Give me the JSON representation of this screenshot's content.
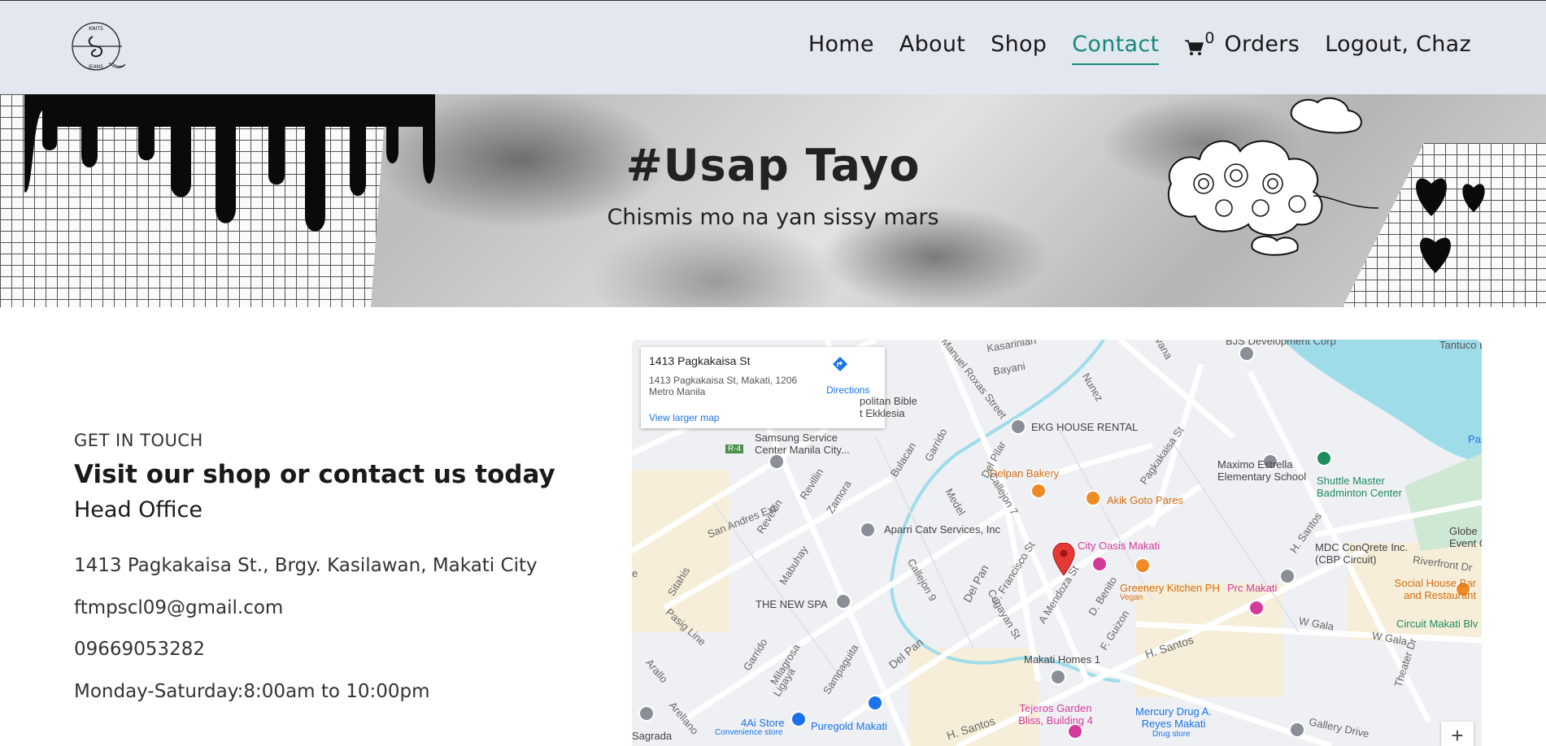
{
  "nav": {
    "items": [
      {
        "label": "Home",
        "active": false
      },
      {
        "label": "About",
        "active": false
      },
      {
        "label": "Shop",
        "active": false
      },
      {
        "label": "Contact",
        "active": true
      }
    ],
    "cart_count": "0",
    "orders_label": "Orders",
    "logout_label": "Logout, Chaz",
    "logo_text_top": "KNITS",
    "logo_text_bottom": "JEANS",
    "accent_color": "#128a78"
  },
  "banner": {
    "title": "#Usap Tayo",
    "subtitle": "Chismis mo na yan sissy mars"
  },
  "contact": {
    "kicker": "GET IN TOUCH",
    "headline": "Visit our shop or contact us today",
    "office_label": "Head Office",
    "address": "1413 Pagkakaisa St., Brgy. Kasilawan, Makati City",
    "email": "ftmpscl09@gmail.com",
    "phone": "09669053282",
    "hours": "Monday-Saturday:8:00am to 10:00pm"
  },
  "map": {
    "card_title": "1413 Pagkakaisa St",
    "card_address": "1413 Pagkakaisa St, Makati, 1206 Metro Manila",
    "directions_label": "Directions",
    "larger_map_label": "View larger map",
    "zoom_in_label": "+",
    "labels": {
      "bjs": "BJS Development Corp",
      "tantuco": "Tantuco E",
      "kasarinlan": "Kasarinlan",
      "bayani": "Bayani",
      "manuel_roxas": "Manuel Roxas Street",
      "nunez": "Nunez",
      "avana": "vana",
      "pasig_river": "Pas",
      "bible": "politan Bible",
      "ekklesia": "t Ekklesia",
      "ekg": "EKG HOUSE RENTAL",
      "samsung": "Samsung Service Center Manila City...",
      "r4": "R-4",
      "delpan_bakery": "Delpan Bakery",
      "akik": "Akik Goto Pares",
      "pagkakaisa": "Pagkakaisa St",
      "maximo": "Maximo Estrella Elementary School",
      "shuttle": "Shuttle Master Badminton Center",
      "globe": "Globe Event C",
      "aparri": "Aparri Catv Services, Inc",
      "city_oasis": "City Oasis Makati",
      "greenery": "Greenery Kitchen PH",
      "vegan": "Vegan",
      "prc": "Prc Makati",
      "mdc": "MDC ConQrete Inc. (CBP Circuit)",
      "riverfront": "Riverfront Dr",
      "social_house": "Social House Bar and Restaurant",
      "circuit": "Circuit Makati Blv",
      "wgala": "W Gala",
      "wgala2": "W Gala",
      "san_andres": "San Andres Ext.",
      "revellin": "Revellin",
      "revillin": "Revillin",
      "zamora": "Zamora",
      "bulacan": "Bulacan",
      "garrido": "Garrido",
      "del_pilar": "Del Pilar",
      "callejon7": "Callejon 7",
      "medel": "Medel",
      "callejon9": "Callejon 9",
      "del_pan": "Del Pan",
      "c_francisco": "C. Francisco St",
      "a_mendoza": "A Mendoza St",
      "d_benito": "D. Benito",
      "f_guizon": "F. Guizon",
      "cagayan": "Cagayan St",
      "mabuhay": "Mabuhay",
      "sitahis": "Sitahis",
      "pasig_line": "Pasig Line",
      "the_new_spa": "THE NEW SPA",
      "garrido2": "Garrido",
      "milagrosa": "Milagrosa",
      "ligaya": "Ligaya",
      "sampaguita": "Sampaguita",
      "del_pan2": "Del Pan",
      "makati_homes": "Makati Homes 1",
      "h_santos": "H. Santos",
      "h_santos2": "H. Santos",
      "h_santos3": "H. Santos",
      "theater": "Theater Dr",
      "arallo": "Arallo",
      "arellano": "Arellano",
      "sagrada": "Sagrada",
      "fouraistore": "4Ai Store",
      "convenience": "Convenience store",
      "puregold": "Puregold Makati",
      "tejeros": "Tejeros Garden Bliss, Building 4",
      "mercury": "Mercury Drug A. Reyes Makati",
      "drugstore": "Drug store",
      "gallery": "Gallery Drive",
      "e_edge": "e"
    }
  }
}
